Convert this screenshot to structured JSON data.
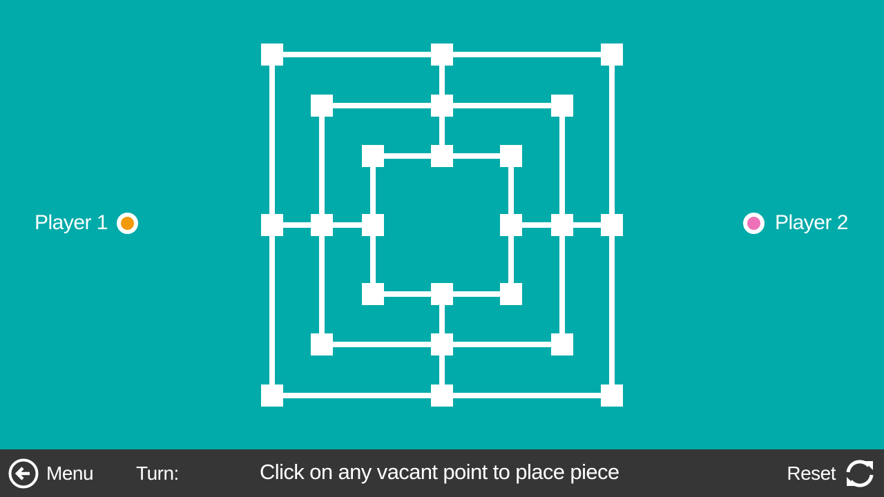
{
  "players": [
    {
      "label": "Player 1",
      "color": "#F39A0B"
    },
    {
      "label": "Player 2",
      "color": "#EE71B8"
    }
  ],
  "bottom_bar": {
    "menu_label": "Menu",
    "menu_icon": "arrow-left-circle-icon",
    "turn_label": "Turn:",
    "status_message": "Click on any vacant point to place piece",
    "reset_label": "Reset",
    "reset_icon": "refresh-icon"
  },
  "colors": {
    "background": "#00ABAA",
    "bar": "#363636",
    "board": "#FFFFFF"
  },
  "board": {
    "game": "Nine Men's Morris",
    "rings": 3,
    "points_per_ring": 8,
    "points_total": 24,
    "occupied_points": 0
  }
}
